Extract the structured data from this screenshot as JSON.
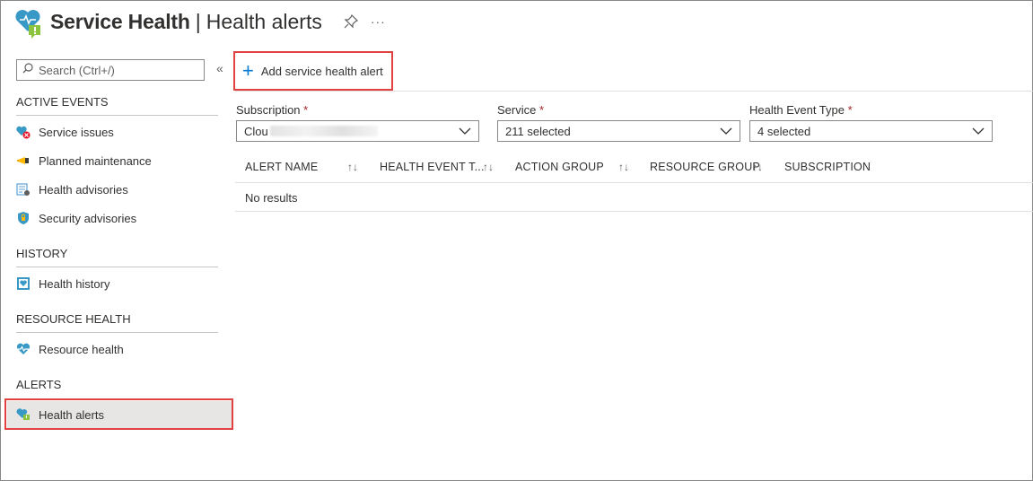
{
  "header": {
    "title": "Service Health",
    "separator": "|",
    "subtitle": "Health alerts",
    "more": "···"
  },
  "sidebar": {
    "search_placeholder": "Search (Ctrl+/)",
    "collapse": "«",
    "sections": [
      {
        "title": "ACTIVE EVENTS",
        "items": [
          {
            "label": "Service issues",
            "icon": "service-issues-icon"
          },
          {
            "label": "Planned maintenance",
            "icon": "planned-maintenance-icon"
          },
          {
            "label": "Health advisories",
            "icon": "health-advisories-icon"
          },
          {
            "label": "Security advisories",
            "icon": "security-advisories-icon"
          }
        ]
      },
      {
        "title": "HISTORY",
        "items": [
          {
            "label": "Health history",
            "icon": "health-history-icon"
          }
        ]
      },
      {
        "title": "RESOURCE HEALTH",
        "items": [
          {
            "label": "Resource health",
            "icon": "resource-health-icon"
          }
        ]
      },
      {
        "title": "ALERTS",
        "items": [
          {
            "label": "Health alerts",
            "icon": "health-alerts-icon",
            "selected": true
          }
        ]
      }
    ]
  },
  "toolbar": {
    "add_label": "Add service health alert"
  },
  "filters": {
    "subscription": {
      "label": "Subscription",
      "required": "*",
      "value": "Clou"
    },
    "service": {
      "label": "Service",
      "required": "*",
      "value": "211 selected"
    },
    "event_type": {
      "label": "Health Event Type",
      "required": "*",
      "value": "4 selected"
    }
  },
  "table": {
    "columns": [
      "ALERT NAME",
      "HEALTH EVENT T...",
      "ACTION GROUP",
      "RESOURCE GROUP",
      "SUBSCRIPTION"
    ],
    "sort_glyph": "↑↓",
    "empty_text": "No results"
  },
  "colors": {
    "accent": "#0078d4",
    "highlight": "#e04141",
    "required": "#a4262c",
    "selected_bg": "#e8e6e4"
  }
}
